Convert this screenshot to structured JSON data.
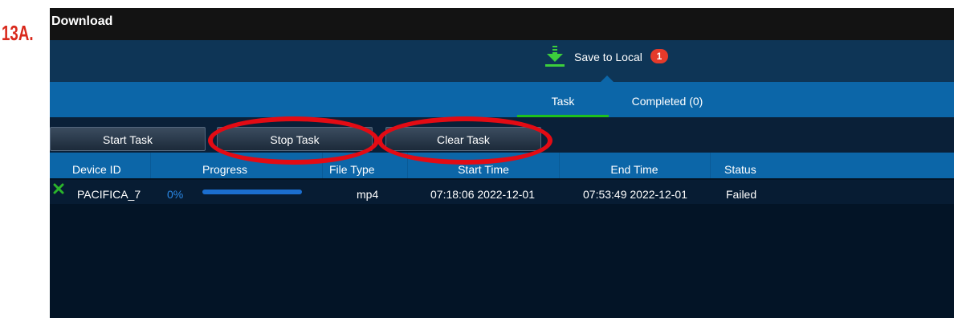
{
  "step_label": "13A.",
  "window": {
    "title": "Download"
  },
  "topbar": {
    "save_label": "Save to Local",
    "badge_count": "1",
    "icon": "download-arrow-icon"
  },
  "tabs": [
    {
      "label": "Task",
      "active": true
    },
    {
      "label": "Completed (0)",
      "active": false
    }
  ],
  "toolbar": {
    "start_label": "Start Task",
    "stop_label": "Stop Task",
    "clear_label": "Clear Task"
  },
  "table": {
    "headers": [
      "Device ID",
      "Progress",
      "File Type",
      "Start Time",
      "End Time",
      "Status"
    ],
    "rows": [
      {
        "status_icon": "x-icon",
        "device_id": "PACIFICA_7",
        "progress_text": "0%",
        "progress_value": 0,
        "file_type": "mp4",
        "start_time": "07:18:06 2022-12-01",
        "end_time": "07:53:49 2022-12-01",
        "status": "Failed"
      }
    ]
  },
  "colors": {
    "accent_green": "#1ec01e",
    "tab_blue": "#0c66a8",
    "badge_red": "#e53a2a",
    "annotation_red": "#e30b14"
  }
}
